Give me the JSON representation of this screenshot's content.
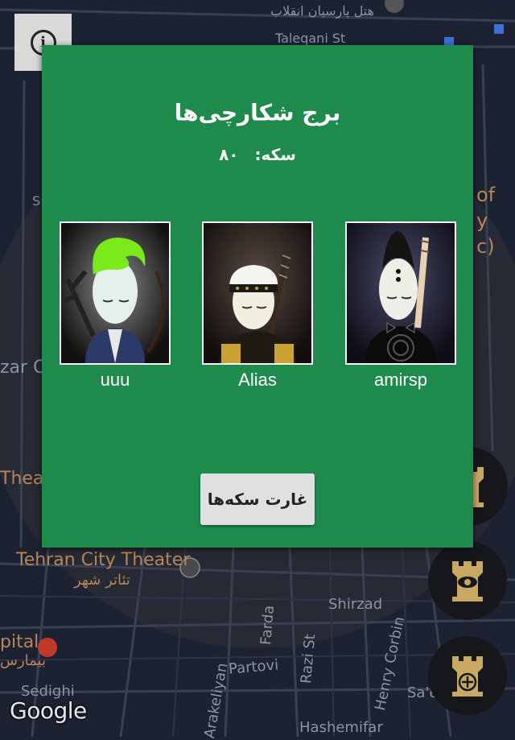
{
  "map": {
    "labels": {
      "hotel": "هتل پارسیان انقلاب",
      "taleqani": "Taleqani St",
      "tehran_city_theater": "Tehran City Theater",
      "theatre_fa": "تئاتر شهر",
      "theatr": "Theatr",
      "zar": "zar C",
      "hospital_en": "pital",
      "hospital_fa": "بیمارس",
      "sedighi": "Sedighi",
      "arakeliyan": "Arakeliyan",
      "farda": "Farda",
      "partovi": "Partovi",
      "razi": "Razi St",
      "henry_corbin": "Henry Corbin",
      "shirzad": "Shirzad",
      "hashemifar": "Hashemifar",
      "sae": "Sa'e",
      "of": "of",
      "y": "y",
      "c": "c)",
      "s": "S"
    },
    "attribution": "Google"
  },
  "info_button": {
    "icon": "info-icon"
  },
  "dialog": {
    "title": "برج شکارچی‌ها",
    "coins_label": "سکه:",
    "coins_value": "۸۰",
    "hunters": [
      {
        "name": "uuu",
        "hair_color": "#7bea1a"
      },
      {
        "name": "Alias",
        "hair_color": "#ffffff"
      },
      {
        "name": "amirsp",
        "hair_color": "#1a1a1a"
      }
    ],
    "raid_button": "غارت سکه‌ها"
  },
  "fabs": [
    {
      "icon": "tower-eye-icon"
    },
    {
      "icon": "tower-plus-icon"
    },
    {
      "icon": "tower-icon"
    }
  ],
  "colors": {
    "dialog_bg": "#1e8a4c",
    "map_bg": "#1c2232",
    "fab_gold": "#c9a864"
  }
}
